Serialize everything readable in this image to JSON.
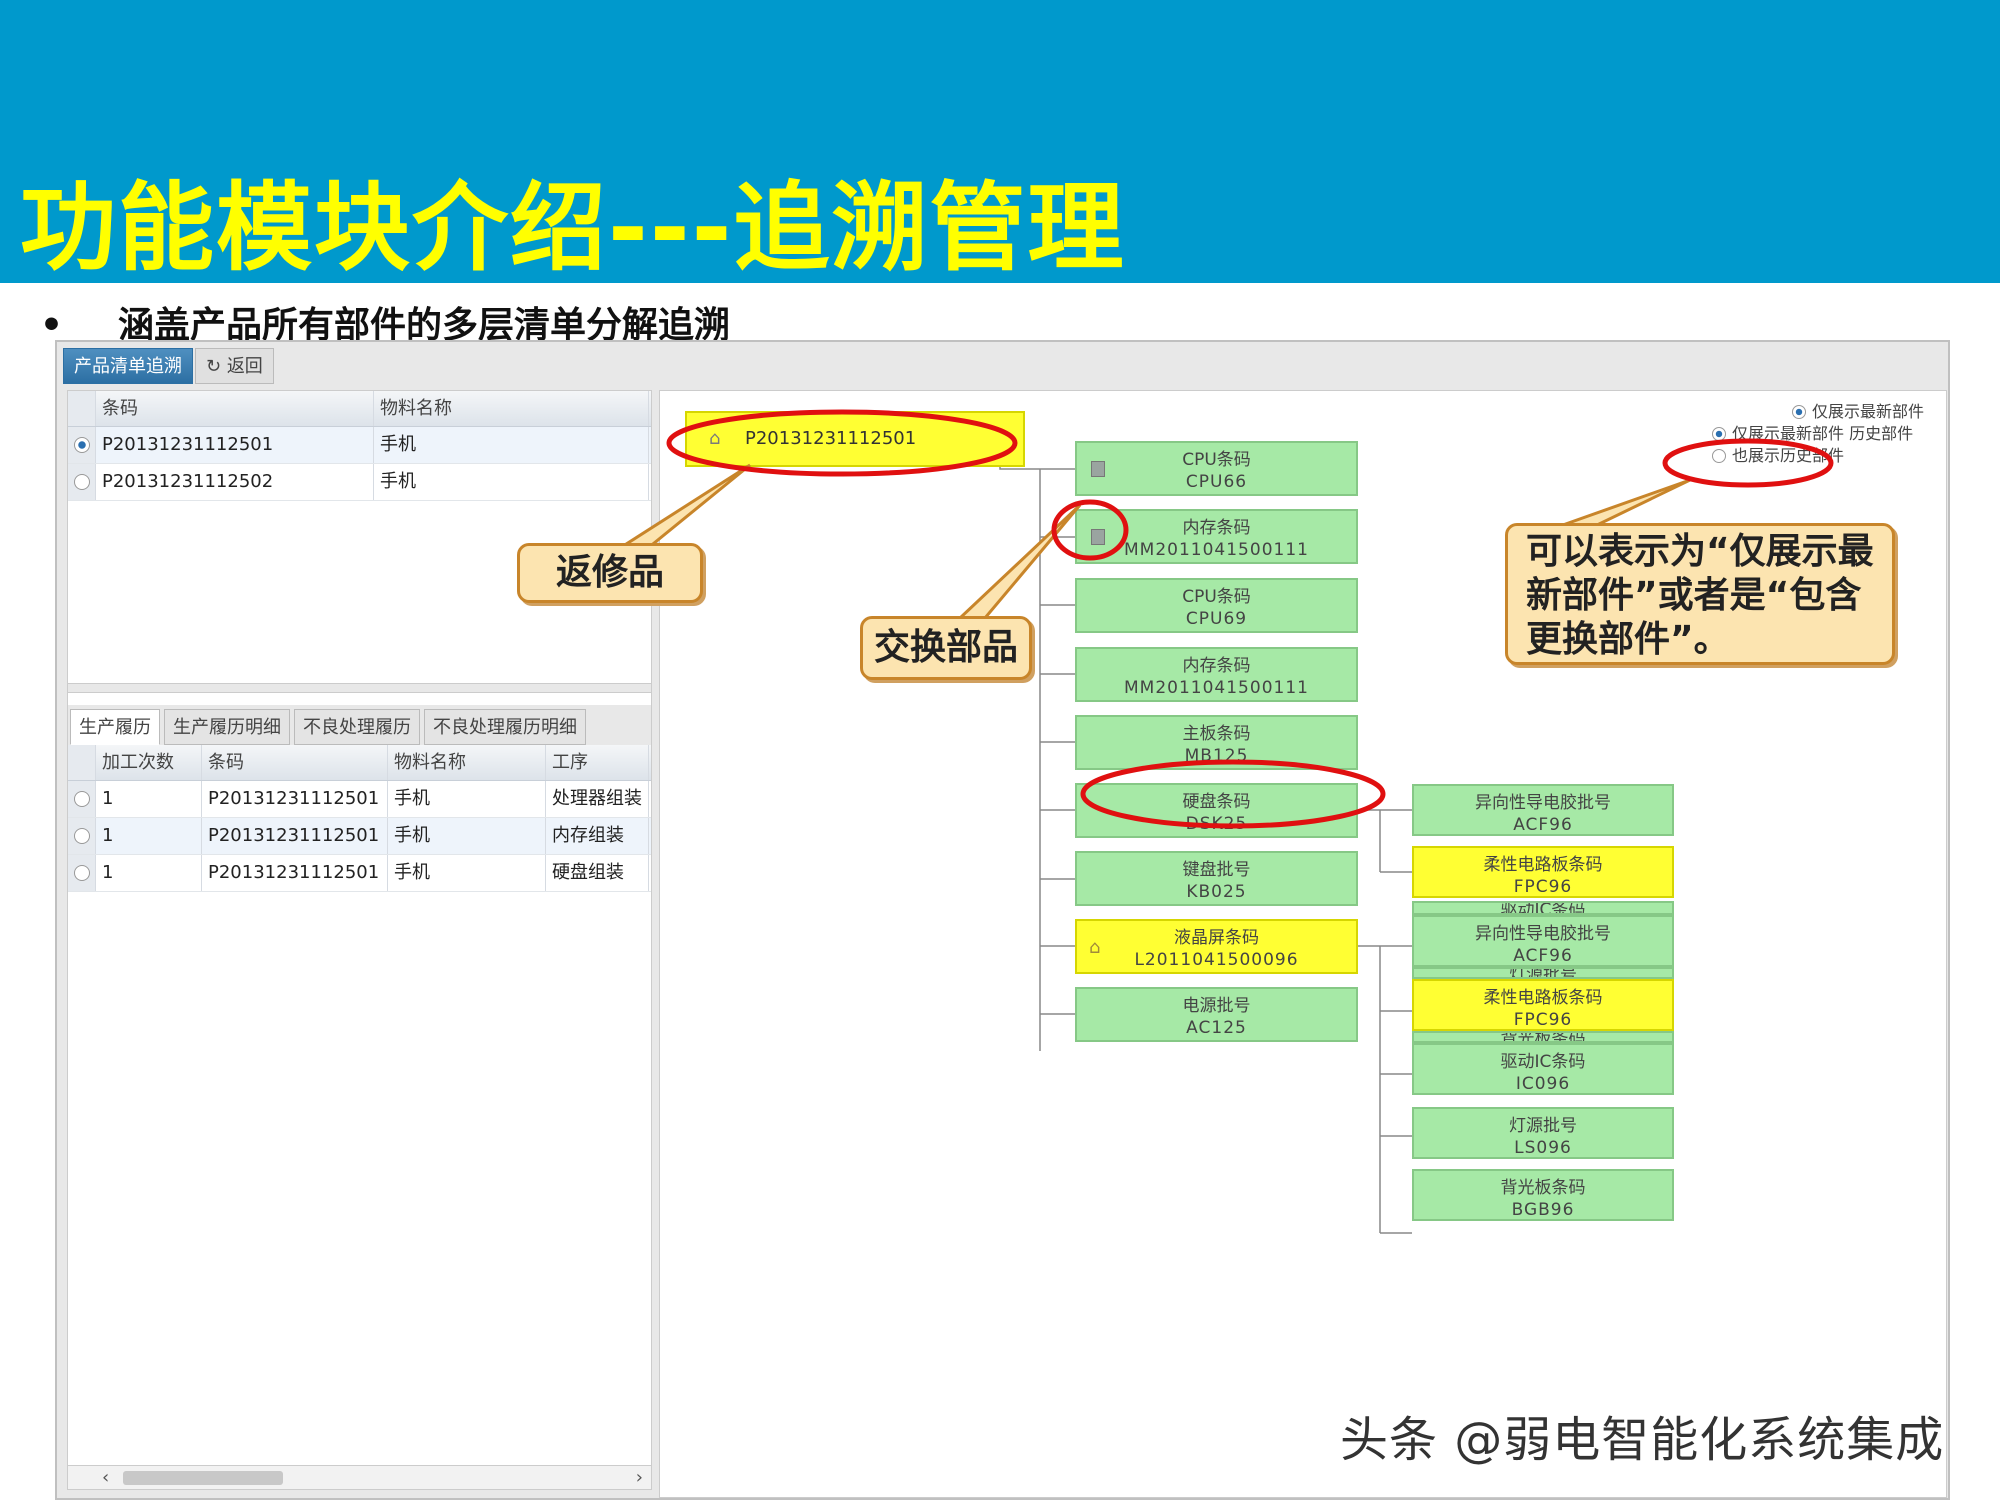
{
  "slide": {
    "title": "功能模块介绍---追溯管理",
    "bullet_mark": "•",
    "bullet": "涵盖产品所有部件的多层清单分解追溯"
  },
  "toolbar": {
    "tab_label": "产品清单追溯",
    "back_label": "返回"
  },
  "product_grid": {
    "headers": [
      "条码",
      "物料名称"
    ],
    "rows": [
      {
        "barcode": "P20131231112501",
        "name": "手机",
        "selected": true
      },
      {
        "barcode": "P20131231112502",
        "name": "手机",
        "selected": false
      }
    ]
  },
  "history_tabs": [
    "生产履历",
    "生产履历明细",
    "不良处理履历",
    "不良处理履历明细"
  ],
  "history_grid": {
    "headers": [
      "加工次数",
      "条码",
      "物料名称",
      "工序"
    ],
    "rows": [
      {
        "count": "1",
        "barcode": "P20131231112501",
        "name": "手机",
        "process": "处理器组装"
      },
      {
        "count": "1",
        "barcode": "P20131231112501",
        "name": "手机",
        "process": "内存组装"
      },
      {
        "count": "1",
        "barcode": "P20131231112501",
        "name": "手机",
        "process": "硬盘组装"
      }
    ]
  },
  "display_options": [
    {
      "label": "仅展示最新部件",
      "selected": true
    },
    {
      "label": "仅展示最新部件 历史部件",
      "selected": true
    },
    {
      "label": "也展示历史部件",
      "selected": false
    }
  ],
  "tree": {
    "root": "P20131231112501",
    "level1": [
      {
        "title": "CPU条码",
        "code": "CPU66",
        "color": "green",
        "icon": "document-icon"
      },
      {
        "title": "内存条码",
        "code": "MM2011041500111",
        "color": "green",
        "icon": "document-icon"
      },
      {
        "title": "CPU条码",
        "code": "CPU69",
        "color": "green"
      },
      {
        "title": "内存条码",
        "code": "MM2011041500111",
        "color": "green"
      },
      {
        "title": "主板条码",
        "code": "MB125",
        "color": "green"
      },
      {
        "title": "硬盘条码",
        "code": "DSK25",
        "color": "green"
      },
      {
        "title": "键盘批号",
        "code": "KB025",
        "color": "green"
      },
      {
        "title": "液晶屏条码",
        "code": "L2011041500096",
        "color": "yellow",
        "icon": "home-icon"
      },
      {
        "title": "电源批号",
        "code": "AC125",
        "color": "green"
      }
    ],
    "level2_group1": [
      {
        "title": "异向性导电胶批号",
        "code": "ACF96",
        "color": "green"
      },
      {
        "title": "柔性电路板条码",
        "code": "FPC96",
        "color": "yellow"
      }
    ],
    "level2_group2": [
      {
        "title": "驱动IC条码",
        "code": "",
        "color": "green"
      },
      {
        "title": "异向性导电胶批号",
        "code": "ACF96",
        "color": "green"
      },
      {
        "title": "灯源批号",
        "code": "",
        "color": "green"
      },
      {
        "title": "柔性电路板条码",
        "code": "FPC96",
        "color": "yellow"
      },
      {
        "title": "背光板条码",
        "code": "",
        "color": "green"
      },
      {
        "title": "驱动IC条码",
        "code": "IC096",
        "color": "green"
      },
      {
        "title": "灯源批号",
        "code": "LS096",
        "color": "green"
      },
      {
        "title": "背光板条码",
        "code": "BGB96",
        "color": "green"
      }
    ]
  },
  "callouts": {
    "repair": "返修品",
    "exchange": "交换部品",
    "options_note": "可以表示为“仅展示最新部件”或者是“包含更换部件”。"
  },
  "watermark": "头条 @弱电智能化系统集成",
  "colors": {
    "banner": "#0099cc",
    "title": "#ffff00",
    "node_green": "#a6e9a6",
    "node_yellow": "#ffff33",
    "highlight_ring": "#e01010"
  }
}
